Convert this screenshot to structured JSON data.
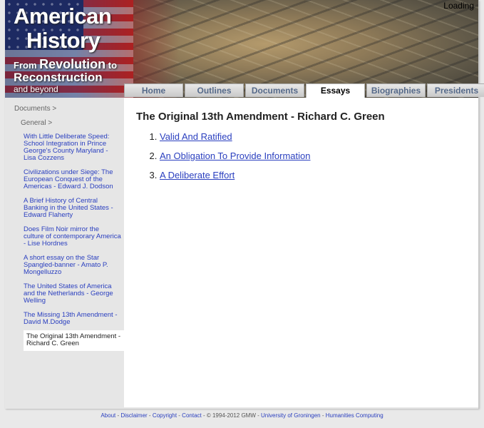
{
  "header": {
    "logo_line1": "American",
    "logo_line2": "History",
    "logo_from": "From",
    "logo_revolution": "Revolution",
    "logo_to": "to",
    "logo_reconstruction": "Reconstruction",
    "logo_beyond": "and beyond",
    "loading": "Loading"
  },
  "tabs": [
    {
      "label": "Home"
    },
    {
      "label": "Outlines"
    },
    {
      "label": "Documents"
    },
    {
      "label": "Essays",
      "active": true
    },
    {
      "label": "Biographies"
    },
    {
      "label": "Presidents"
    }
  ],
  "sidebar": {
    "crumb1": "Documents >",
    "crumb2": "General >",
    "items": [
      "With Little Deliberate Speed: School Integration in Prince George's County Maryland - Lisa Cozzens",
      "Civilizations under Siege: The European Conquest of the Americas - Edward J. Dodson",
      "A Brief History of Central Banking in the United States - Edward Flaherty",
      "Does Film Noir mirror the culture of contemporary America - Lise Hordnes",
      "A short essay on the Star Spangled-banner - Amato P. Mongelluzzo",
      "The United States of America and the Netherlands - George Welling",
      "The Missing 13th Amendment - David M.Dodge"
    ],
    "current": "The Original 13th Amendment - Richard C. Green"
  },
  "main": {
    "title": "The Original 13th Amendment - Richard C. Green",
    "links": [
      "Valid And Ratified",
      "An Obligation To Provide Information",
      "A Deliberate Effort"
    ]
  },
  "footer": {
    "about": "About",
    "disclaimer": "Disclaimer",
    "copyright": "Copyright",
    "contact": "Contact",
    "notice": "© 1994-2012 GMW",
    "university": "University of Groningen",
    "humanities": "Humanities Computing",
    "sep": " - "
  }
}
